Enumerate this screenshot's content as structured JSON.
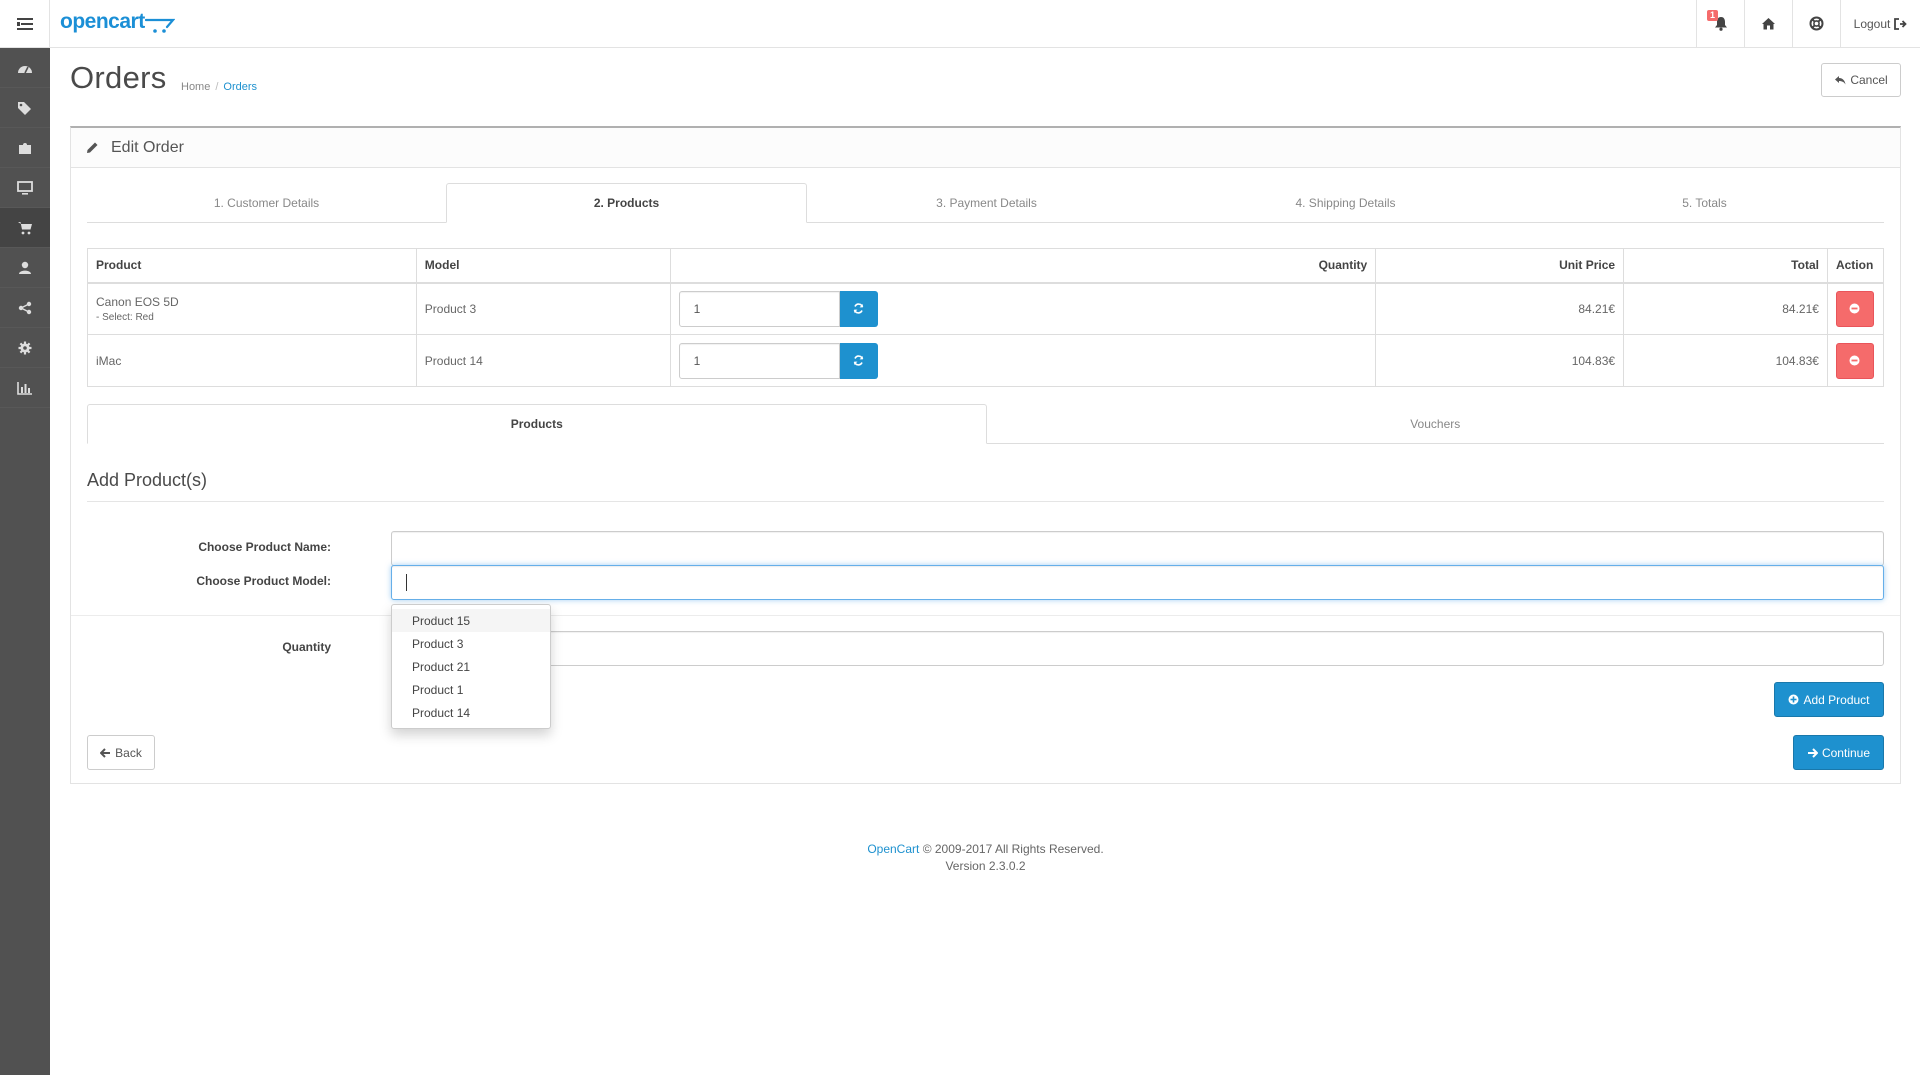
{
  "header": {
    "logo_text": "opencart",
    "notification_count": "1",
    "logout_label": "Logout"
  },
  "sidebar": {
    "items": [
      {
        "icon": "dashboard-icon"
      },
      {
        "icon": "tags-icon"
      },
      {
        "icon": "puzzle-icon"
      },
      {
        "icon": "desktop-icon"
      },
      {
        "icon": "shopping-cart-icon"
      },
      {
        "icon": "user-icon"
      },
      {
        "icon": "share-icon"
      },
      {
        "icon": "cog-icon"
      },
      {
        "icon": "bar-chart-icon"
      }
    ],
    "active_index": 4
  },
  "page": {
    "title": "Orders",
    "breadcrumb": [
      "Home",
      "Orders"
    ],
    "cancel_label": "Cancel"
  },
  "panel": {
    "heading": "Edit Order"
  },
  "steps": {
    "tabs": [
      "1. Customer Details",
      "2. Products",
      "3. Payment Details",
      "4. Shipping Details",
      "5. Totals"
    ],
    "active_index": 1
  },
  "products_table": {
    "headers": [
      "Product",
      "Model",
      "Quantity",
      "Unit Price",
      "Total",
      "Action"
    ],
    "rows": [
      {
        "product": "Canon EOS 5D",
        "option": "- Select: Red",
        "model": "Product 3",
        "quantity": "1",
        "unit_price": "84.21€",
        "total": "84.21€"
      },
      {
        "product": "iMac",
        "option": "",
        "model": "Product 14",
        "quantity": "1",
        "unit_price": "104.83€",
        "total": "104.83€"
      }
    ]
  },
  "sub_tabs": {
    "tabs": [
      "Products",
      "Vouchers"
    ],
    "active_index": 0
  },
  "add_product": {
    "legend": "Add Product(s)",
    "name_label": "Choose Product Name:",
    "name_value": "",
    "model_label": "Choose Product Model:",
    "model_value": "",
    "quantity_label": "Quantity",
    "quantity_value": "",
    "autocomplete": [
      "Product 15",
      "Product 3",
      "Product 21",
      "Product 1",
      "Product 14"
    ],
    "autocomplete_hover_index": 0,
    "add_button_label": "Add Product"
  },
  "nav_buttons": {
    "back_label": "Back",
    "continue_label": "Continue"
  },
  "footer": {
    "brand_link": "OpenCart",
    "copyright": "© 2009-2017 All Rights Reserved.",
    "version": "Version 2.3.0.2"
  },
  "colors": {
    "primary": "#1e91cf",
    "danger": "#f56b6b",
    "sidebar": "#515151"
  }
}
